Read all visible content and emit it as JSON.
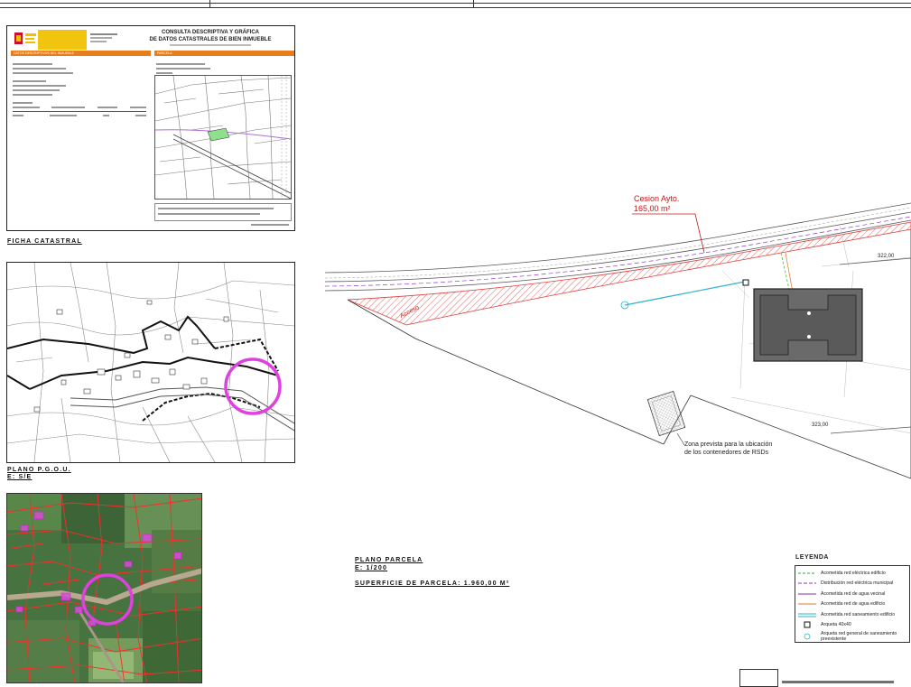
{
  "ficha": {
    "caption": "FICHA CATASTRAL",
    "header_title_line1": "CONSULTA DESCRIPTIVA Y GRÁFICA",
    "header_title_line2": "DE DATOS CATASTRALES DE BIEN INMUEBLE",
    "left_section_bar": "DATOS DESCRIPTIVOS DEL INMUEBLE",
    "right_section_bar": "PARCELA"
  },
  "pgou": {
    "caption_line1": "PLANO P.G.O.U.",
    "caption_line2": "E: S/E"
  },
  "parcela": {
    "title": "PLANO PARCELA",
    "scale": "E: 1/200",
    "surface": "SUPERFICIE DE PARCELA:   1.960,00 M²",
    "cesion_line1": "Cesion Ayto.",
    "cesion_line2": "165,00 m²",
    "acceso": "Acceso",
    "elev_1": "322,00",
    "elev_2": "323,00",
    "zona_line1": "Zona prevista para la ubicación",
    "zona_line2": "de los contenedores de RSDs"
  },
  "leyenda": {
    "title": "LEYENDA",
    "items": [
      {
        "label": "Acometida red eléctrica edificio",
        "color": "#2eaa3a"
      },
      {
        "label": "Distribución red eléctrica municipal",
        "color": "#8a3cc8"
      },
      {
        "label": "Acometida red de agua vecinal",
        "color": "#7a3aa0"
      },
      {
        "label": "Acometida red de agua edificio",
        "color": "#e07a20"
      },
      {
        "label": "Acometida red saneamiento edificio",
        "color": "#2ab3c8"
      },
      {
        "label": "Arqueta 40x40",
        "color": "#111111"
      },
      {
        "label": "Arqueta red general de saneamiento preexistente",
        "color": "#2ab3c8"
      }
    ]
  },
  "colors": {
    "accent_orange": "#e87d1e",
    "hatch_red": "#e03a3a",
    "circle_magenta": "#e040e0",
    "building_gray": "#6a6a6a"
  }
}
